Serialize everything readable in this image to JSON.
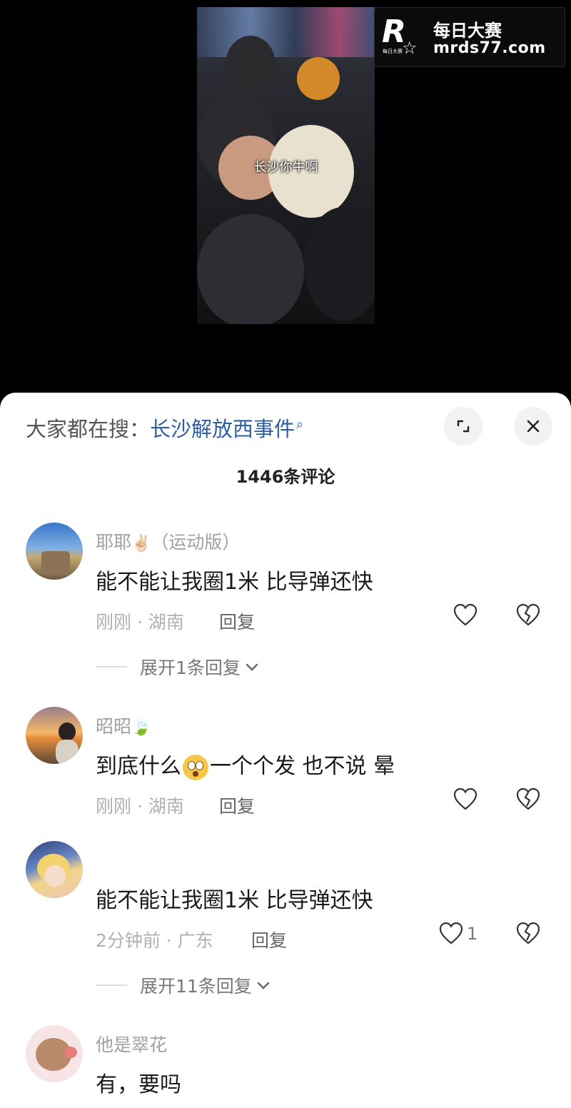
{
  "video": {
    "caption": "长沙你牛啊",
    "watermark": {
      "brand_letter": "R",
      "brand_small": "每日大赛",
      "brand_cn": "每日大赛",
      "url": "mrds77.com"
    }
  },
  "sheet": {
    "search_prefix": "大家都在搜：",
    "search_keyword": "长沙解放西事件",
    "comment_count_title": "1446条评论"
  },
  "comments": [
    {
      "username": "耶耶",
      "username_badge": "✌🏻",
      "username_suffix": "（运动版）",
      "text": "能不能让我圈1米 比导弹还快",
      "meta": "刚刚 · 湖南",
      "reply_label": "回复",
      "likes": "",
      "expand_label": "展开1条回复"
    },
    {
      "username": "昭昭",
      "username_badge": "🍃",
      "text_before": "到底什么",
      "text_after": "一个个发 也不说 晕",
      "meta": "刚刚 · 湖南",
      "reply_label": "回复",
      "likes": ""
    },
    {
      "username": "",
      "text": "能不能让我圈1米 比导弹还快",
      "meta": "2分钟前 · 广东",
      "reply_label": "回复",
      "likes": "1",
      "expand_label": "展开11条回复"
    },
    {
      "username": "他是翠花",
      "text": "有，要吗"
    }
  ],
  "icons": {
    "search": "search-icon",
    "expand": "expand-icon",
    "close": "close-icon",
    "like": "heart-icon",
    "dislike": "broken-heart-icon",
    "chevron": "chevron-down-icon"
  },
  "colors": {
    "link": "#2f5fa0",
    "muted": "#b0b0b0",
    "text": "#1a1a1a"
  }
}
